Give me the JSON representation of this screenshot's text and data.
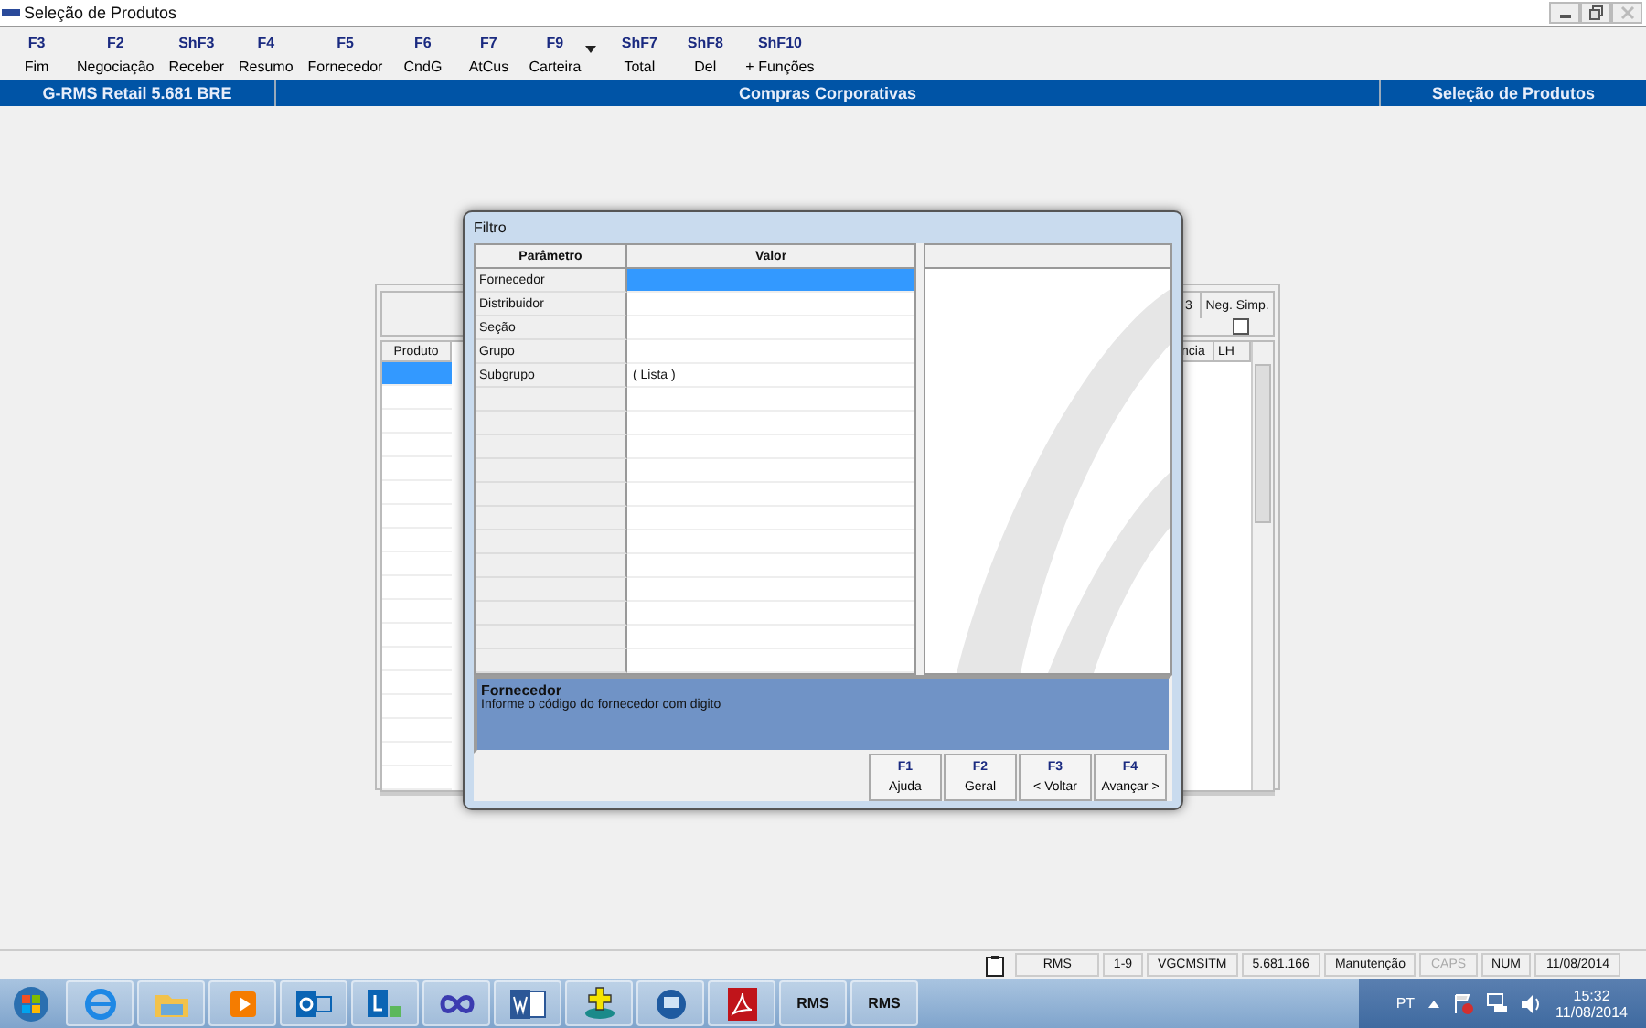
{
  "window": {
    "title": "Seleção de Produtos"
  },
  "toolbar": [
    {
      "key": "F3",
      "label": "Fim"
    },
    {
      "key": "F2",
      "label": "Negociação"
    },
    {
      "key": "ShF3",
      "label": "Receber"
    },
    {
      "key": "F4",
      "label": "Resumo"
    },
    {
      "key": "F5",
      "label": "Fornecedor"
    },
    {
      "key": "F6",
      "label": "CndG"
    },
    {
      "key": "F7",
      "label": "AtCus"
    },
    {
      "key": "F9",
      "label": "Carteira",
      "dropdown": true
    },
    {
      "key": "ShF7",
      "label": "Total"
    },
    {
      "key": "ShF8",
      "label": "Del"
    },
    {
      "key": "ShF10",
      "label": "+ Funções"
    }
  ],
  "header_bar": {
    "product": "G-RMS Retail 5.681 BRE",
    "module": "Compras Corporativas",
    "screen": "Seleção de Produtos"
  },
  "background_window": {
    "column_header": "Produto",
    "top_right_cell": "3",
    "option_header": "Neg. Simp.",
    "option_checked": false,
    "right_headers": [
      "ncia",
      "LH"
    ]
  },
  "dialog": {
    "title": "Filtro",
    "columns": [
      "Parâmetro",
      "Valor"
    ],
    "rows": [
      {
        "parameter": "Fornecedor",
        "value": "",
        "selected": true
      },
      {
        "parameter": "Distribuidor",
        "value": "",
        "selected": false
      },
      {
        "parameter": "Seção",
        "value": "",
        "selected": false
      },
      {
        "parameter": "Grupo",
        "value": "",
        "selected": false
      },
      {
        "parameter": "Subgrupo",
        "value": "( Lista )",
        "selected": false
      }
    ],
    "help": {
      "title": "Fornecedor",
      "text": "Informe o código do fornecedor com digito"
    },
    "buttons": [
      {
        "key": "F1",
        "label": "Ajuda"
      },
      {
        "key": "F2",
        "label": "Geral"
      },
      {
        "key": "F3",
        "label": "< Voltar"
      },
      {
        "key": "F4",
        "label": "Avançar >"
      }
    ]
  },
  "status_bar": [
    {
      "text": "RMS",
      "active": true
    },
    {
      "text": "1-9",
      "active": true
    },
    {
      "text": "VGCMSITM",
      "active": true
    },
    {
      "text": "5.681.166",
      "active": true
    },
    {
      "text": "Manutenção",
      "active": true
    },
    {
      "text": "CAPS",
      "active": false
    },
    {
      "text": "NUM",
      "active": true
    },
    {
      "text": "11/08/2014",
      "active": true
    }
  ],
  "taskbar": {
    "apps": [
      {
        "kind": "browser"
      },
      {
        "kind": "folder"
      },
      {
        "kind": "media"
      },
      {
        "kind": "mail"
      },
      {
        "kind": "lync"
      },
      {
        "kind": "infinity"
      },
      {
        "kind": "word"
      },
      {
        "kind": "plus"
      },
      {
        "kind": "globe"
      },
      {
        "kind": "pdf"
      },
      {
        "kind": "rms",
        "label": "RMS"
      },
      {
        "kind": "rms",
        "label": "RMS"
      }
    ],
    "language": "PT",
    "time": "15:32",
    "date": "11/08/2014"
  }
}
